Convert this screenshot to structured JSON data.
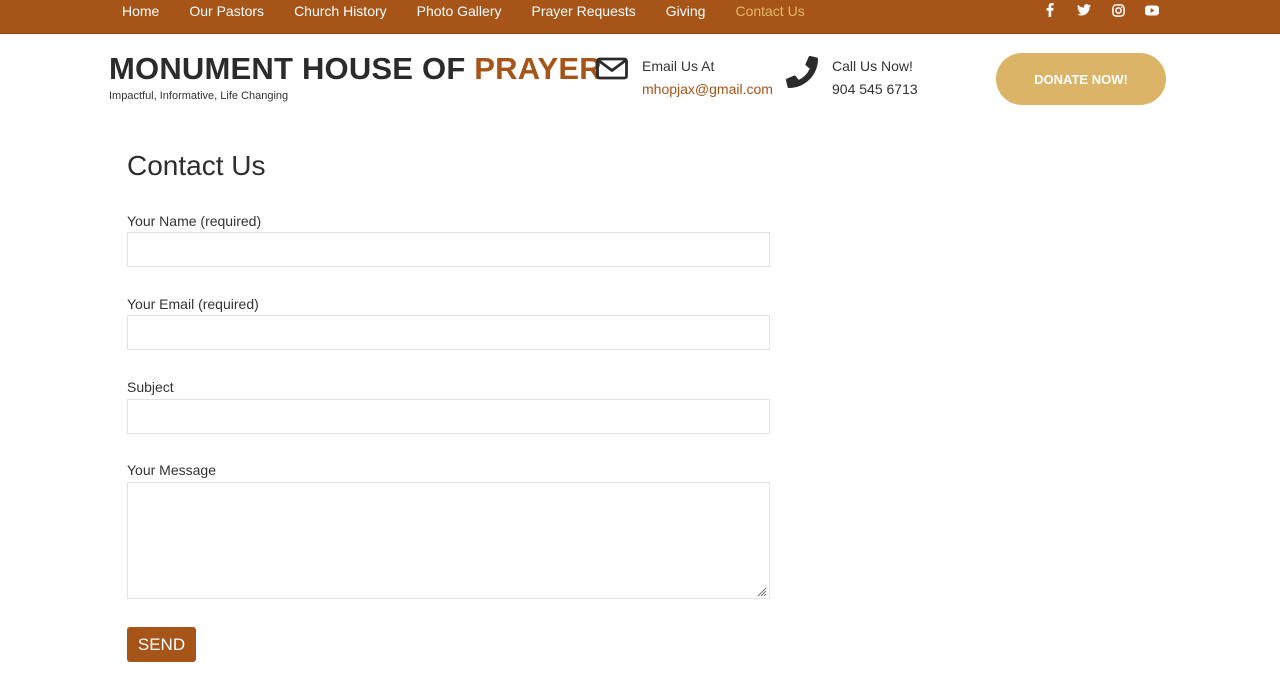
{
  "nav": {
    "items": [
      {
        "label": "Home",
        "active": false
      },
      {
        "label": "Our Pastors",
        "active": false
      },
      {
        "label": "Church History",
        "active": false
      },
      {
        "label": "Photo Gallery",
        "active": false
      },
      {
        "label": "Prayer Requests",
        "active": false
      },
      {
        "label": "Giving",
        "active": false
      },
      {
        "label": "Contact Us",
        "active": true
      }
    ],
    "social_icons": [
      "facebook-icon",
      "twitter-icon",
      "instagram-icon",
      "youtube-icon"
    ]
  },
  "header": {
    "brand_main": "MONUMENT HOUSE OF ",
    "brand_accent": "PRAYER",
    "tagline": "Impactful, Informative, Life Changing",
    "email_label": "Email Us At",
    "email_value": "mhopjax@gmail.com",
    "phone_label": "Call Us Now!",
    "phone_value": "904 545 6713",
    "donate_label": "DONATE NOW!"
  },
  "form": {
    "title": "Contact Us",
    "name_label": "Your Name (required)",
    "name_value": "",
    "email_label": "Your Email (required)",
    "email_value": "",
    "subject_label": "Subject",
    "subject_value": "",
    "message_label": "Your Message",
    "message_value": "",
    "send_label": "SEND"
  },
  "colors": {
    "brand": "#a65418",
    "active_nav": "#e0b96a",
    "donate": "#dbb468"
  }
}
